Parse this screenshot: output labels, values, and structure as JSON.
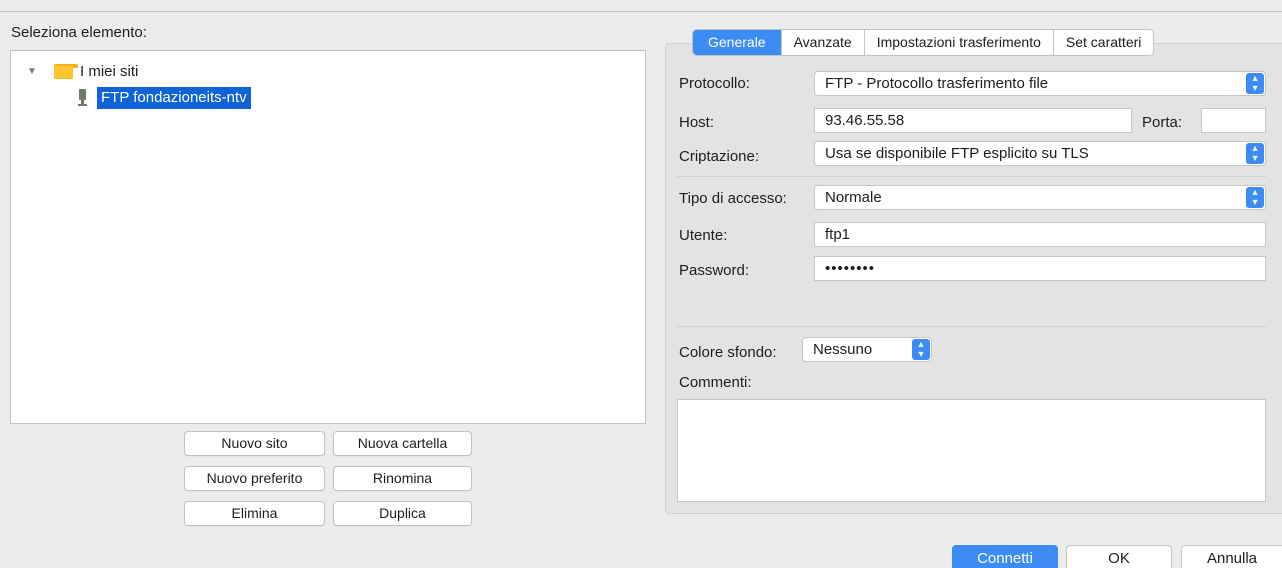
{
  "left_panel": {
    "select_label": "Seleziona elemento:",
    "tree": {
      "root_label": "I miei siti",
      "child_label": "FTP fondazioneits-ntv"
    },
    "buttons": {
      "new_site": "Nuovo sito",
      "new_folder": "Nuova cartella",
      "new_bookmark": "Nuovo preferito",
      "rename": "Rinomina",
      "delete": "Elimina",
      "duplicate": "Duplica"
    }
  },
  "tabs": [
    "Generale",
    "Avanzate",
    "Impostazioni trasferimento",
    "Set caratteri"
  ],
  "form": {
    "protocol_label": "Protocollo:",
    "protocol_value": "FTP - Protocollo trasferimento file",
    "host_label": "Host:",
    "host_value": "93.46.55.58",
    "port_label": "Porta:",
    "port_value": "",
    "encryption_label": "Criptazione:",
    "encryption_value": "Usa se disponibile FTP esplicito su TLS",
    "access_type_label": "Tipo di accesso:",
    "access_type_value": "Normale",
    "user_label": "Utente:",
    "user_value": "ftp1",
    "password_label": "Password:",
    "password_value": "••••••••",
    "bg_color_label": "Colore sfondo:",
    "bg_color_value": "Nessuno",
    "comments_label": "Commenti:",
    "comments_value": ""
  },
  "footer": {
    "connect": "Connetti",
    "ok": "OK",
    "cancel": "Annulla"
  },
  "colors": {
    "accent": "#3d8cf6",
    "selection": "#0f63d6",
    "folder": "#fcc42e"
  }
}
